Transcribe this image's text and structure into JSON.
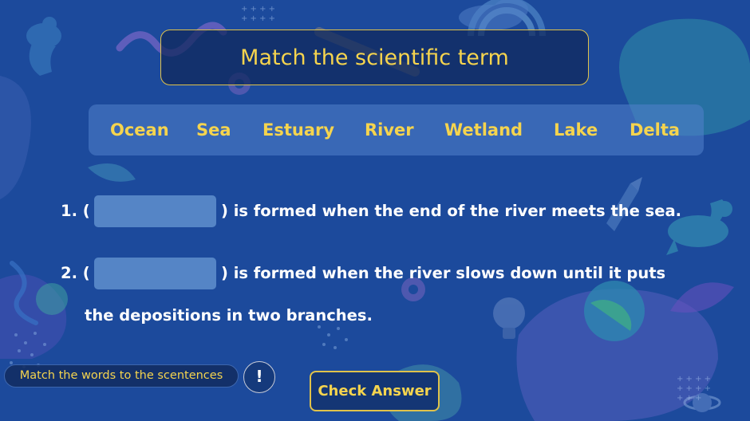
{
  "title": "Match the scientific term",
  "word_bank": [
    "Ocean",
    "Sea",
    "Estuary",
    "River",
    "Wetland",
    "Lake",
    "Delta"
  ],
  "questions": [
    {
      "number": "1. (",
      "text": ") is formed when the end of the river meets the sea."
    },
    {
      "number": "2. (",
      "text": ") is formed when the river slows down until it puts",
      "text_line2": "the depositions in two branches."
    }
  ],
  "blanks": [
    "",
    ""
  ],
  "footer": {
    "hint": "Match the words to the scentences",
    "info_glyph": "!",
    "check_label": "Check Answer"
  },
  "colors": {
    "background": "#1c4a9c",
    "accent": "#f5d44e",
    "blank_fill": "#5585c6"
  },
  "icons": [
    "dinosaur-icon",
    "rainbow-icon",
    "planet-icon",
    "lightbulb-icon",
    "gear-icon",
    "cloud-icon",
    "rocket-icon",
    "stars-icon"
  ]
}
